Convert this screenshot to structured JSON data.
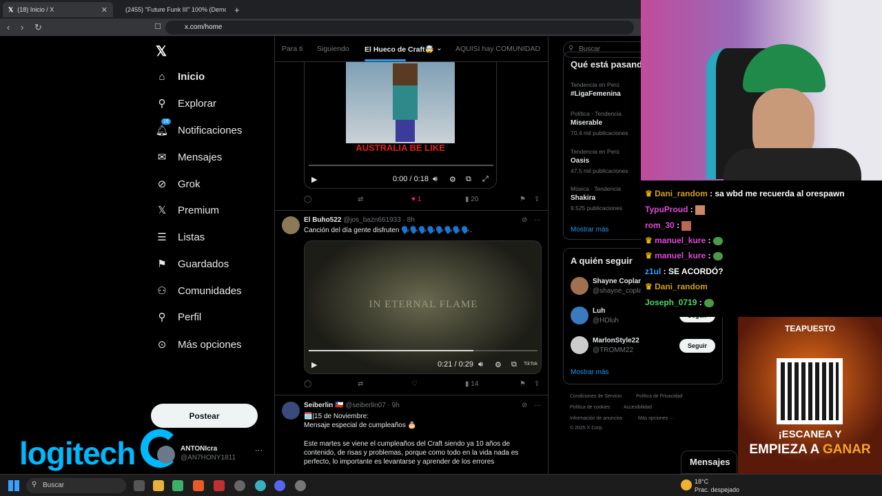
{
  "browser": {
    "tabs": [
      {
        "title": "(18) Inicio / X",
        "active": true
      },
      {
        "title": "(2455) \"Future Funk III\" 100% (Demo",
        "active": false
      }
    ],
    "new_tab": "+",
    "url": "x.com/home"
  },
  "nav": {
    "items": [
      {
        "label": "Inicio",
        "icon": "home-icon"
      },
      {
        "label": "Explorar",
        "icon": "search-icon"
      },
      {
        "label": "Notificaciones",
        "icon": "bell-icon",
        "badge": "18"
      },
      {
        "label": "Mensajes",
        "icon": "envelope-icon"
      },
      {
        "label": "Grok",
        "icon": "grok-icon"
      },
      {
        "label": "Premium",
        "icon": "x-logo-icon"
      },
      {
        "label": "Listas",
        "icon": "list-icon"
      },
      {
        "label": "Guardados",
        "icon": "bookmark-icon"
      },
      {
        "label": "Comunidades",
        "icon": "people-icon"
      },
      {
        "label": "Perfil",
        "icon": "person-icon"
      },
      {
        "label": "Más opciones",
        "icon": "more-circle-icon"
      }
    ],
    "post_button": "Postear",
    "account": {
      "name": "ANTONIcra",
      "handle": "@AN7HONY1811"
    },
    "logo_text": "logitech"
  },
  "feed": {
    "tabs": [
      "Para ti",
      "Siguiendo",
      "El Hueco de Craft🤯",
      "AQUISI hay COMUNIDAD"
    ],
    "video1": {
      "caption": "AUSTRALIA BE LIKE",
      "time": "0:00 / 0:18",
      "likes": "1",
      "views": "20"
    },
    "tweet2": {
      "name": "El Buho522",
      "handle": "@jos_bazn661933 · 8h",
      "text": "Canción del día gente disfruten 🗣️🗣️🗣️🗣️🗣️🗣️🗣️🗣️.",
      "video_caption": "IN ETERNAL FLAME",
      "watermark": "TikTok",
      "time": "0:21 / 0:29",
      "views": "14"
    },
    "tweet3": {
      "name": "Seiberlin 🇨🇱",
      "handle": "@seiberlin07 · 9h",
      "line1": "🗓️|15 de Noviembre:",
      "line2": "Mensaje especial de cumpleaños 🎂",
      "body": "Este martes se viene el cumpleaños del Craft siendo ya 10 años de contenido, de risas y problemas, porque como todo en la vida nada es perfecto, lo importante es levantarse y aprender de los errores"
    }
  },
  "right": {
    "search_placeholder": "Buscar",
    "trends_title": "Qué está pasando",
    "trends": [
      {
        "meta": "Tendencia en Perú",
        "name": "#LigaFemenina",
        "count": ""
      },
      {
        "meta": "Política · Tendencia",
        "name": "Miserable",
        "count": "70,4 mil publicaciones"
      },
      {
        "meta": "Tendencia en Perú",
        "name": "Oasis",
        "count": "47,5 mil publicaciones"
      },
      {
        "meta": "Música · Tendencia",
        "name": "Shakira",
        "count": "9.525 publicaciones"
      }
    ],
    "show_more": "Mostrar más",
    "follow_title": "A quién seguir",
    "follow": [
      {
        "name": "Shayne Coplan",
        "handle": "@shayne_coplan"
      },
      {
        "name": "Luh",
        "handle": "@HDluh"
      },
      {
        "name": "MarlonStyle22",
        "handle": "@TROMM22"
      }
    ],
    "follow_button": "Seguir",
    "footer": [
      "Condiciones de Servicio",
      "Política de Privacidad",
      "Política de cookies",
      "Accesibilidad",
      "Información de anuncios",
      "Más opciones ···",
      "© 2025 X Corp."
    ],
    "messages": "Mensajes"
  },
  "chat": [
    {
      "user": "Dani_random",
      "msg": "sa wbd me recuerda al orespawn",
      "color": "#d4a017"
    },
    {
      "user": "TypuProud",
      "msg": "",
      "color": "#e04ad8"
    },
    {
      "user": "rom_30",
      "msg": "",
      "color": "#e04ad8"
    },
    {
      "user": "manuel_kure",
      "msg": "",
      "color": "#e04ad8"
    },
    {
      "user": "manuel_kure",
      "msg": "",
      "color": "#e04ad8"
    },
    {
      "user": "z1ul",
      "msg": "SE ACORDÓ?",
      "color": "#3aa0ff"
    },
    {
      "user": "Dani_random",
      "msg": "",
      "color": "#d4a017"
    },
    {
      "user": "Joseph_0719",
      "msg": "",
      "color": "#4ad86a"
    }
  ],
  "ad": {
    "brand": "TEAPUESTO",
    "line1": "¡ESCANEA Y",
    "line2": "EMPIEZA A",
    "line3": "GANAR"
  },
  "taskbar": {
    "search": "Buscar",
    "weather_temp": "18°C",
    "weather_desc": "Prac. despejado"
  }
}
